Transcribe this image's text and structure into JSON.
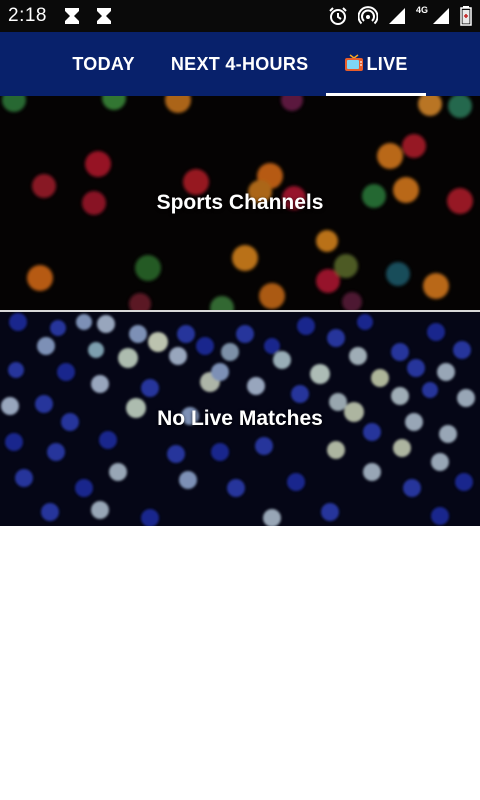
{
  "status_bar": {
    "time": "2:18",
    "network_label": "4G",
    "icons": [
      "hourglass-icon",
      "hourglass-icon",
      "alarm-icon",
      "hotspot-icon",
      "signal-icon",
      "signal-4g-icon",
      "battery-icon"
    ]
  },
  "tabs": [
    {
      "label": "TODAY",
      "active": false
    },
    {
      "label": "NEXT 4-HOURS",
      "active": false
    },
    {
      "label": "LIVE",
      "active": true,
      "icon": "tv-icon"
    }
  ],
  "cards": [
    {
      "title": "Sports Channels"
    },
    {
      "title": "No Live Matches"
    }
  ],
  "colors": {
    "status_bar": "#0a0a0a",
    "tab_bar": "#08216b",
    "indicator": "#ffffff",
    "background": "#ffffff"
  }
}
